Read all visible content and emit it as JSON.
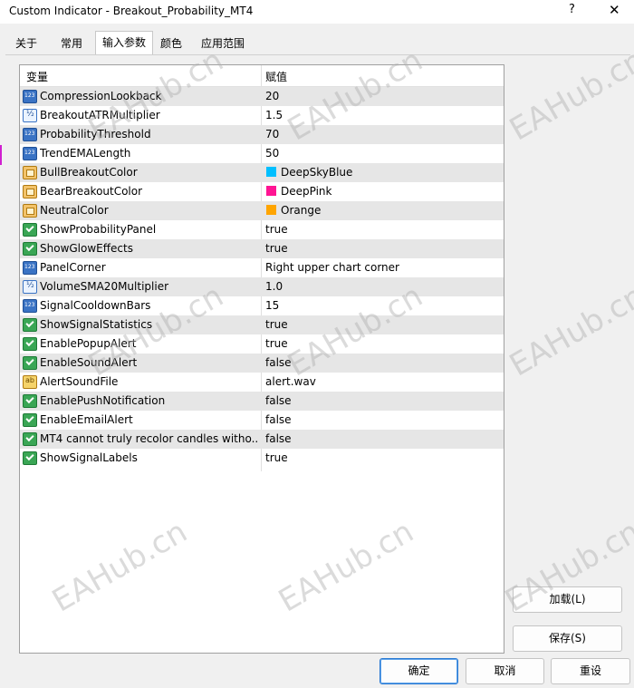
{
  "window": {
    "title": "Custom Indicator - Breakout_Probability_MT4",
    "help_glyph": "?",
    "close_glyph": "✕"
  },
  "tabs": [
    {
      "label": "关于"
    },
    {
      "label": "常用"
    },
    {
      "label": "输入参数",
      "active": true
    },
    {
      "label": "颜色"
    },
    {
      "label": "应用范围"
    }
  ],
  "grid": {
    "headers": {
      "variable": "变量",
      "value": "赋值"
    },
    "rows": [
      {
        "icon": "int-icon",
        "name": "CompressionLookback",
        "value": "20"
      },
      {
        "icon": "double-icon",
        "name": "BreakoutATRMultiplier",
        "value": "1.5"
      },
      {
        "icon": "int-icon",
        "name": "ProbabilityThreshold",
        "value": "70"
      },
      {
        "icon": "int-icon",
        "name": "TrendEMALength",
        "value": "50"
      },
      {
        "icon": "color-icon",
        "name": "BullBreakoutColor",
        "value": "DeepSkyBlue",
        "swatch": "#00bfff"
      },
      {
        "icon": "color-icon",
        "name": "BearBreakoutColor",
        "value": "DeepPink",
        "swatch": "#ff1493"
      },
      {
        "icon": "color-icon",
        "name": "NeutralColor",
        "value": "Orange",
        "swatch": "#ffa500"
      },
      {
        "icon": "bool-icon",
        "name": "ShowProbabilityPanel",
        "value": "true"
      },
      {
        "icon": "bool-icon",
        "name": "ShowGlowEffects",
        "value": "true"
      },
      {
        "icon": "enum-icon",
        "name": "PanelCorner",
        "value": "Right upper chart corner"
      },
      {
        "icon": "double-icon",
        "name": "VolumeSMA20Multiplier",
        "value": "1.0"
      },
      {
        "icon": "int-icon",
        "name": "SignalCooldownBars",
        "value": "15"
      },
      {
        "icon": "bool-icon",
        "name": "ShowSignalStatistics",
        "value": "true"
      },
      {
        "icon": "bool-icon",
        "name": "EnablePopupAlert",
        "value": "true"
      },
      {
        "icon": "bool-icon",
        "name": "EnableSoundAlert",
        "value": "false"
      },
      {
        "icon": "string-icon",
        "name": "AlertSoundFile",
        "value": "alert.wav"
      },
      {
        "icon": "bool-icon",
        "name": "EnablePushNotification",
        "value": "false"
      },
      {
        "icon": "bool-icon",
        "name": "EnableEmailAlert",
        "value": "false"
      },
      {
        "icon": "bool-icon",
        "name": "MT4 cannot truly recolor candles witho...",
        "value": "false"
      },
      {
        "icon": "bool-icon",
        "name": "ShowSignalLabels",
        "value": "true"
      }
    ]
  },
  "buttons": {
    "load": "加载(L)",
    "save": "保存(S)",
    "ok": "确定",
    "cancel": "取消",
    "reset": "重设"
  },
  "watermark": "EAHub.cn"
}
